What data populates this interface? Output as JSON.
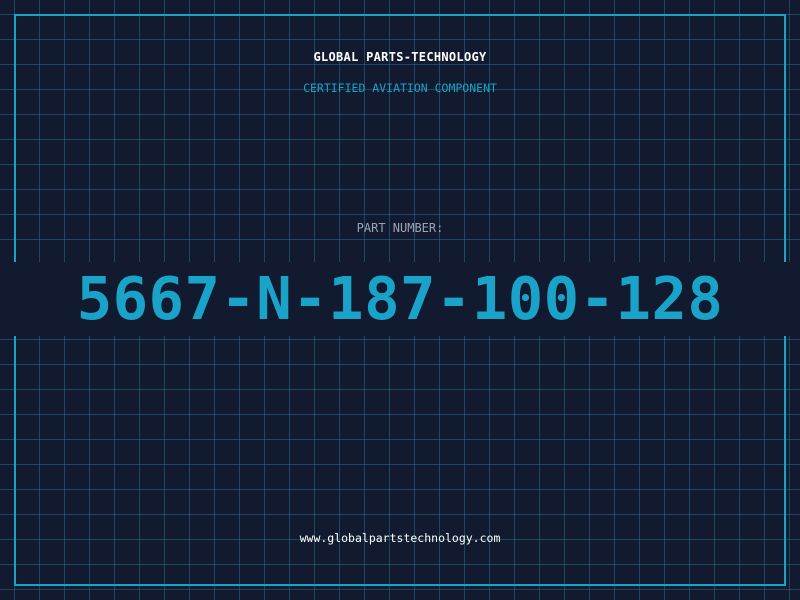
{
  "brand": "GLOBAL PARTS-TECHNOLOGY",
  "subtitle": "CERTIFIED AVIATION COMPONENT",
  "part_number_label": "PART NUMBER:",
  "part_number": "5667-N-187-100-128",
  "website": "www.globalpartstechnology.com",
  "colors": {
    "background": "#111a2e",
    "grid": "#286e8c",
    "accent": "#1aa3c8",
    "label": "#9aa4b4",
    "text": "#ffffff"
  }
}
